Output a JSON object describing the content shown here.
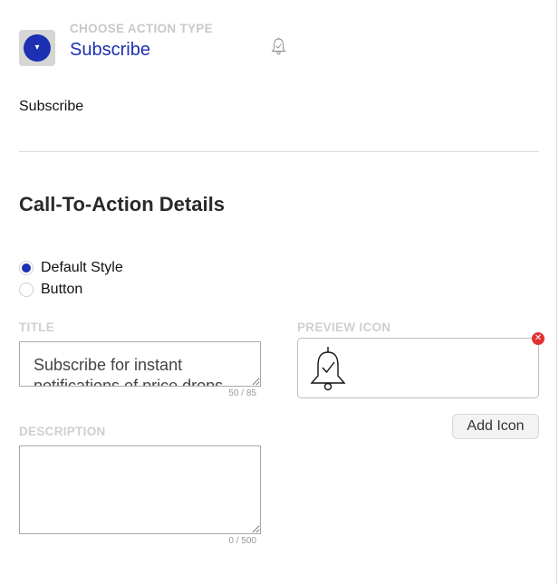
{
  "action_type": {
    "label": "CHOOSE ACTION TYPE",
    "value": "Subscribe",
    "toggle_glyph": "▾",
    "accent": "#1d2fb2"
  },
  "action_text": "Subscribe",
  "details": {
    "title": "Call-To-Action Details"
  },
  "style_options": [
    {
      "label": "Default Style",
      "checked": true
    },
    {
      "label": "Button",
      "checked": false
    }
  ],
  "title_field": {
    "label": "TITLE",
    "value": "Subscribe for instant notifications of price drops",
    "counter": "50 / 85"
  },
  "description_field": {
    "label": "DESCRIPTION",
    "value": "",
    "counter": "0 / 500"
  },
  "preview": {
    "label": "PREVIEW ICON",
    "icon": "bell-check-icon",
    "remove_icon": "close-icon",
    "remove_glyph": "✕",
    "remove_color": "#e03131"
  },
  "add_icon_button": {
    "label": "Add Icon"
  }
}
